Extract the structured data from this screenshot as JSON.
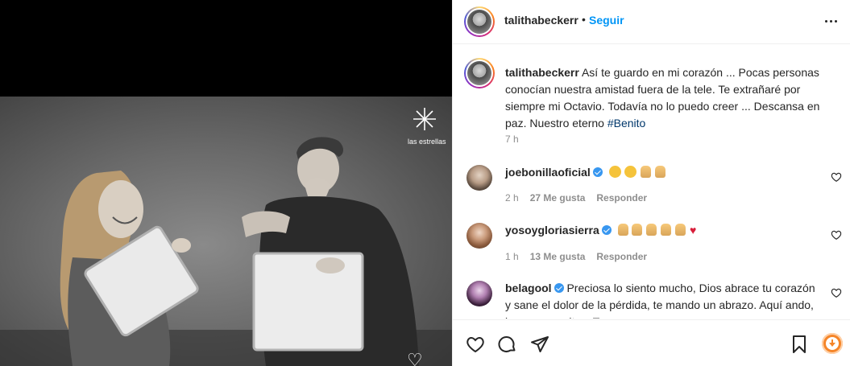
{
  "post": {
    "username": "talithabeckerr",
    "follow_label": "Seguir",
    "separator": "•",
    "watermark": "las estrellas"
  },
  "caption": {
    "username": "talithabeckerr",
    "text": "Así te guardo en mi corazón ... Pocas personas conocían nuestra amistad fuera de la tele. Te extrañaré por siempre mi Octavio. Todavía no lo puedo creer ... Descansa en paz. Nuestro eterno ",
    "hashtag": "#Benito",
    "time": "7 h"
  },
  "comments": [
    {
      "username": "joebonillaoficial",
      "verified": true,
      "emojis": [
        "sad",
        "sad",
        "pray",
        "pray"
      ],
      "time": "2 h",
      "likes": "27 Me gusta",
      "reply": "Responder"
    },
    {
      "username": "yosoygloriasierra",
      "verified": true,
      "emojis": [
        "pray",
        "pray",
        "pray",
        "pray",
        "pray",
        "heart"
      ],
      "time": "1 h",
      "likes": "13 Me gusta",
      "reply": "Responder"
    },
    {
      "username": "belagool",
      "verified": true,
      "text": "Preciosa lo siento mucho, Dios abrace tu corazón y sane el dolor de la pérdida, te mando un abrazo. Aquí ando, lo que necesites. Tqm"
    }
  ],
  "colors": {
    "accent": "#0095f6",
    "hashtag": "#00376b",
    "muted": "#8e8e8e",
    "verified": "#3897f0",
    "heart": "#d81e3a"
  },
  "icons": [
    "more-icon",
    "heart-icon",
    "comment-icon",
    "share-icon",
    "bookmark-icon",
    "verified-icon",
    "download-icon"
  ]
}
